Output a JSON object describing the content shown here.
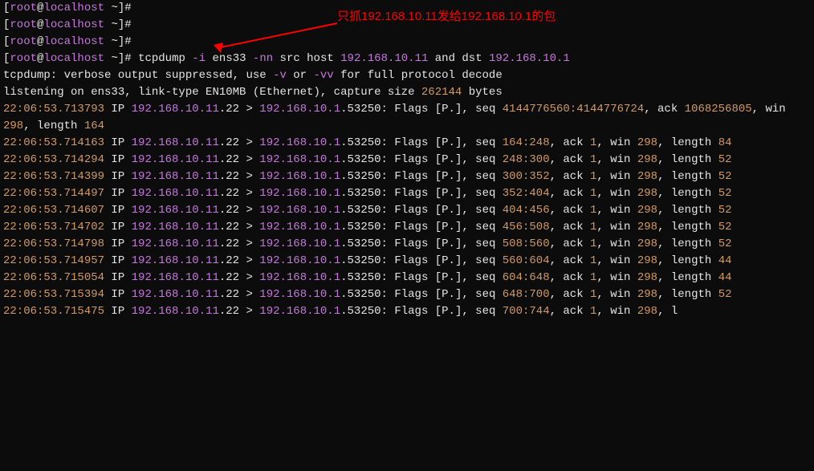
{
  "prompt": {
    "lbracket": "[",
    "user": "root",
    "at": "@",
    "host": "localhost",
    "tilde": " ~",
    "rbracket_hash": "]#"
  },
  "command": {
    "cmd": " tcpdump ",
    "flag_i": "-i",
    "iface": " ens33 ",
    "flag_nn": "-nn",
    "src_host": " src host ",
    "ip1": "192.168.10.11",
    "and": " and",
    "dst": " dst ",
    "ip2": "192.168.10.1"
  },
  "annotation_text": "只抓192.168.10.11发给192.168.10.1的包",
  "tcpdump_msg1": {
    "p1": "tcpdump: verbose output suppressed, use ",
    "v": "-v",
    "or": " or ",
    "vv": "-vv",
    "p2": " for full protocol decode"
  },
  "tcpdump_msg2": {
    "p1": "listening on ens33, link-type EN10MB (Ethernet), capture size ",
    "size": "262144",
    "bytes": " bytes"
  },
  "packets": [
    {
      "ts": "22:06:53.713793",
      "src_ip": "192.168.10.11",
      "src_port": ".22",
      "dst_ip": "192.168.10.1",
      "dst_port": ".53250",
      "seq": "4144776560:4144776724",
      "ack": "1068256805",
      "win": "298",
      "length": "164",
      "wrap_before_ack": true
    },
    {
      "ts": "22:06:53.714163",
      "src_ip": "192.168.10.11",
      "src_port": ".22",
      "dst_ip": "192.168.10.1",
      "dst_port": ".53250",
      "seq": "164:248",
      "ack": "1",
      "win": "298",
      "length": "84"
    },
    {
      "ts": "22:06:53.714294",
      "src_ip": "192.168.10.11",
      "src_port": ".22",
      "dst_ip": "192.168.10.1",
      "dst_port": ".53250",
      "seq": "248:300",
      "ack": "1",
      "win": "298",
      "length": "52"
    },
    {
      "ts": "22:06:53.714399",
      "src_ip": "192.168.10.11",
      "src_port": ".22",
      "dst_ip": "192.168.10.1",
      "dst_port": ".53250",
      "seq": "300:352",
      "ack": "1",
      "win": "298",
      "length": "52"
    },
    {
      "ts": "22:06:53.714497",
      "src_ip": "192.168.10.11",
      "src_port": ".22",
      "dst_ip": "192.168.10.1",
      "dst_port": ".53250",
      "seq": "352:404",
      "ack": "1",
      "win": "298",
      "length": "52"
    },
    {
      "ts": "22:06:53.714607",
      "src_ip": "192.168.10.11",
      "src_port": ".22",
      "dst_ip": "192.168.10.1",
      "dst_port": ".53250",
      "seq": "404:456",
      "ack": "1",
      "win": "298",
      "length": "52"
    },
    {
      "ts": "22:06:53.714702",
      "src_ip": "192.168.10.11",
      "src_port": ".22",
      "dst_ip": "192.168.10.1",
      "dst_port": ".53250",
      "seq": "456:508",
      "ack": "1",
      "win": "298",
      "length": "52"
    },
    {
      "ts": "22:06:53.714798",
      "src_ip": "192.168.10.11",
      "src_port": ".22",
      "dst_ip": "192.168.10.1",
      "dst_port": ".53250",
      "seq": "508:560",
      "ack": "1",
      "win": "298",
      "length": "52"
    },
    {
      "ts": "22:06:53.714957",
      "src_ip": "192.168.10.11",
      "src_port": ".22",
      "dst_ip": "192.168.10.1",
      "dst_port": ".53250",
      "seq": "560:604",
      "ack": "1",
      "win": "298",
      "length": "44"
    },
    {
      "ts": "22:06:53.715054",
      "src_ip": "192.168.10.11",
      "src_port": ".22",
      "dst_ip": "192.168.10.1",
      "dst_port": ".53250",
      "seq": "604:648",
      "ack": "1",
      "win": "298",
      "length": "44"
    },
    {
      "ts": "22:06:53.715394",
      "src_ip": "192.168.10.11",
      "src_port": ".22",
      "dst_ip": "192.168.10.1",
      "dst_port": ".53250",
      "seq": "648:700",
      "ack": "1",
      "win": "298",
      "length": "52"
    },
    {
      "ts": "22:06:53.715475",
      "src_ip": "192.168.10.11",
      "src_port": ".22",
      "dst_ip": "192.168.10.1",
      "dst_port": ".53250",
      "seq": "700:744",
      "ack": "1",
      "win": "298",
      "length_cutoff": true
    }
  ]
}
